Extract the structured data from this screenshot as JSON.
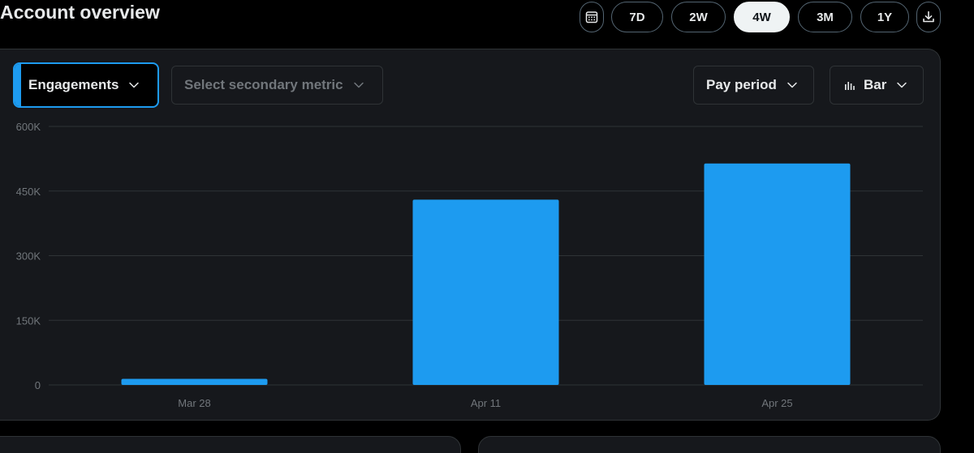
{
  "header": {
    "title": "Account overview"
  },
  "range": {
    "buttons": [
      {
        "label": "7D",
        "active": false
      },
      {
        "label": "2W",
        "active": false
      },
      {
        "label": "4W",
        "active": true
      },
      {
        "label": "3M",
        "active": false
      },
      {
        "label": "1Y",
        "active": false
      }
    ],
    "calendar_icon": "calendar-icon",
    "download_icon": "download-icon"
  },
  "controls": {
    "primary_metric": "Engagements",
    "secondary_metric_placeholder": "Select secondary metric",
    "period": "Pay period",
    "chart_type": "Bar",
    "chart_type_icon": "bar-chart-icon"
  },
  "colors": {
    "accent": "#1d9bf0",
    "background": "#000000",
    "card": "#16181c",
    "border": "#2f3336",
    "grid": "#2f3336",
    "muted_text": "#71767b"
  },
  "chart_data": {
    "type": "bar",
    "categories": [
      "Mar 28",
      "Apr 11",
      "Apr 25"
    ],
    "values": [
      14000,
      430000,
      514000
    ],
    "ylim": [
      0,
      600000
    ],
    "y_ticks": [
      0,
      150000,
      300000,
      450000,
      600000
    ],
    "y_tick_labels": [
      "0",
      "150K",
      "300K",
      "450K",
      "600K"
    ],
    "title": "",
    "xlabel": "",
    "ylabel": "",
    "grid": true,
    "legend": "none",
    "bar_color": "#1d9bf0"
  }
}
